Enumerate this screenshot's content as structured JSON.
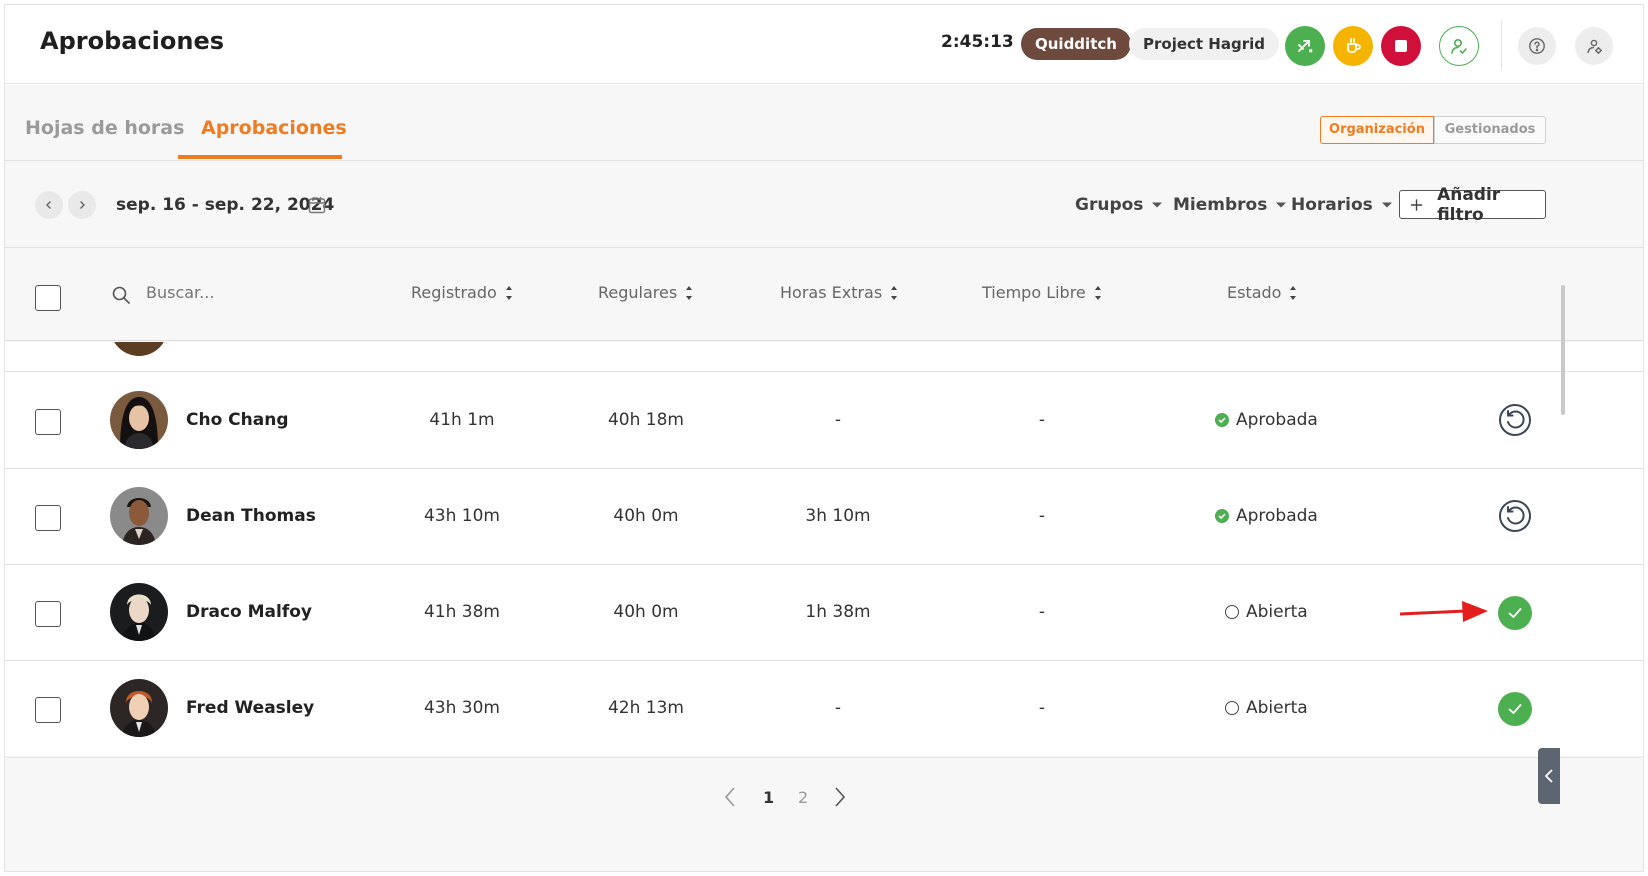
{
  "header": {
    "title": "Aprobaciones",
    "timer": "2:45:13",
    "project_pill": "Quidditch",
    "project_name": "Project Hagrid",
    "action_icons": [
      "switch-task-icon",
      "break-cup-icon",
      "stop-icon",
      "user-approve-icon",
      "help-icon",
      "settings-icon"
    ]
  },
  "tabs": [
    {
      "label": "Hojas de horas",
      "active": false
    },
    {
      "label": "Aprobaciones",
      "active": true
    }
  ],
  "scope_toggle": {
    "options": [
      "Organización",
      "Gestionados"
    ],
    "selected": "Organización"
  },
  "filters": {
    "date_range": "sep. 16 - sep. 22, 2024",
    "dropdowns": [
      "Grupos",
      "Miembros",
      "Horarios"
    ],
    "add_filter_label": "Añadir filtro"
  },
  "table": {
    "search_placeholder": "Buscar...",
    "columns": [
      "Registrado",
      "Regulares",
      "Horas Extras",
      "Tiempo Libre",
      "Estado"
    ],
    "rows": [
      {
        "name": "Cho Chang",
        "registrado": "41h 1m",
        "regulares": "40h 18m",
        "extras": "-",
        "libre": "-",
        "estado": "Aprobada",
        "action": "revert-icon"
      },
      {
        "name": "Dean Thomas",
        "registrado": "43h 10m",
        "regulares": "40h 0m",
        "extras": "3h 10m",
        "libre": "-",
        "estado": "Aprobada",
        "action": "revert-icon"
      },
      {
        "name": "Draco Malfoy",
        "registrado": "41h 38m",
        "regulares": "40h 0m",
        "extras": "1h 38m",
        "libre": "-",
        "estado": "Abierta",
        "action": "approve-check-icon"
      },
      {
        "name": "Fred Weasley",
        "registrado": "43h 30m",
        "regulares": "42h 13m",
        "extras": "-",
        "libre": "-",
        "estado": "Abierta",
        "action": "approve-check-icon"
      }
    ]
  },
  "pagination": {
    "pages": [
      "1",
      "2"
    ],
    "current": "1"
  },
  "colors": {
    "accent": "#f07c21",
    "success": "#4caf50",
    "danger": "#d0103a",
    "warning": "#f5b400",
    "pill_dark": "#6e4a3e"
  }
}
